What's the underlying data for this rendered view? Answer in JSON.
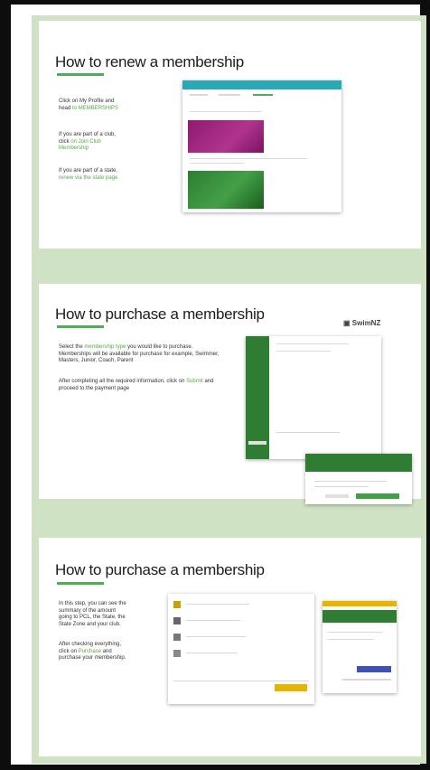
{
  "sections": [
    {
      "title": "How to renew a membership",
      "paragraphs": [
        {
          "before": "Click on My Profile and head",
          "link": "to MEMBERSHIPS",
          "after": ""
        },
        {
          "before": "If you are part of a club, click",
          "link": "on Join Club Membership",
          "after": ""
        },
        {
          "before": "If you are part of a state,",
          "link": "",
          "after": "renew via the state page"
        }
      ]
    },
    {
      "title": "How to purchase a membership",
      "logo": "▣ SwimNZ",
      "paragraphs": [
        {
          "before": "Select the",
          "link": "membership type",
          "after": "you would like to purchase. Memberships will be available for purchase for example, Swimmer, Masters, Junior, Coach, Parent"
        },
        {
          "before": "After completing all the required information, click on",
          "link": "Submit",
          "after": "and proceed to the payment page"
        }
      ]
    },
    {
      "title": "How to purchase a membership",
      "paragraphs": [
        {
          "before": "In this step, you can see the summary of the amount going to PCL, the State, the State Zone and your club.",
          "link": "",
          "after": ""
        },
        {
          "before": "After checking everything, click on",
          "link": "Purchase",
          "after": "and purchase your membership."
        }
      ]
    }
  ],
  "colors": {
    "accent": "#4caf50",
    "frame": "#0d0d0d",
    "background": "#cfe3c4",
    "teal": "#29a8b8",
    "magenta": "#8e1a6e",
    "green": "#2e7d32",
    "yellow": "#e8b400"
  }
}
